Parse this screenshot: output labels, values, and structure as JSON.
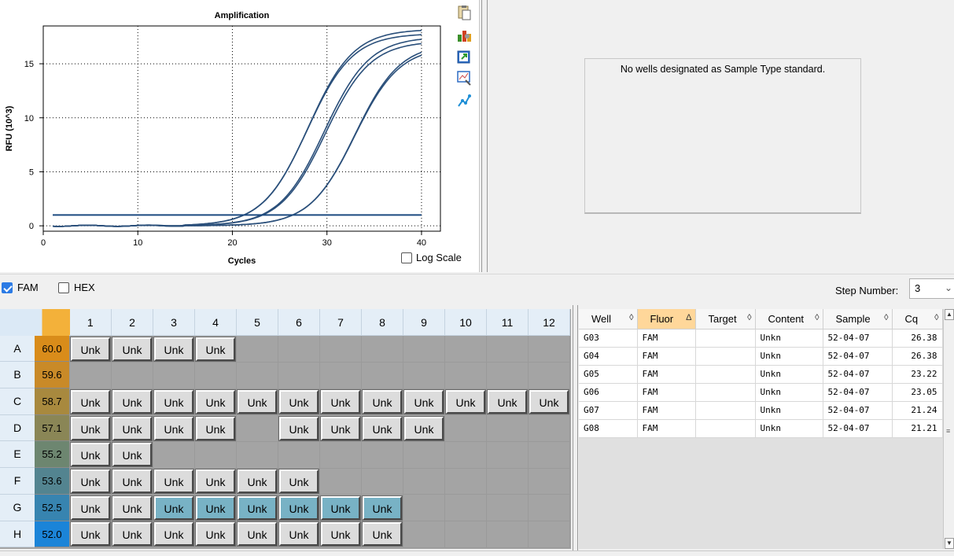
{
  "chart": {
    "log_scale_label": "Log Scale",
    "log_scale_checked": false,
    "toolbar_icons": [
      "clipboard-icon",
      "chart-tools-icon",
      "export-icon",
      "zoom-graph-icon",
      "line-chart-icon"
    ]
  },
  "chart_data": {
    "type": "line",
    "title": "Amplification",
    "xlabel": "Cycles",
    "ylabel": "RFU (10^3)",
    "xlim": [
      0,
      42
    ],
    "ylim": [
      -0.5,
      18.5
    ],
    "xticks": [
      0,
      10,
      20,
      30,
      40
    ],
    "yticks": [
      0,
      5,
      10,
      15
    ],
    "grid": true,
    "threshold": 1.0,
    "series": [
      {
        "cq": 21.21,
        "plateau": 17.8
      },
      {
        "cq": 21.24,
        "plateau": 18.2
      },
      {
        "cq": 23.05,
        "plateau": 17.5
      },
      {
        "cq": 23.22,
        "plateau": 17.1
      },
      {
        "cq": 26.38,
        "plateau": 16.9
      },
      {
        "cq": 26.38,
        "plateau": 16.6
      }
    ]
  },
  "standard_curve": {
    "message": "No wells designated as Sample Type standard."
  },
  "fluors": [
    {
      "label": "FAM",
      "checked": true
    },
    {
      "label": "HEX",
      "checked": false
    }
  ],
  "step": {
    "label": "Step Number:",
    "value": "3"
  },
  "plate": {
    "columns": [
      "1",
      "2",
      "3",
      "4",
      "5",
      "6",
      "7",
      "8",
      "9",
      "10",
      "11",
      "12"
    ],
    "rows": [
      {
        "label": "A",
        "temp": "60.0",
        "color": "#d98c1a",
        "wells": [
          "Unk",
          "Unk",
          "Unk",
          "Unk",
          "",
          "",
          "",
          "",
          "",
          "",
          "",
          ""
        ]
      },
      {
        "label": "B",
        "temp": "59.6",
        "color": "#c98a28",
        "wells": [
          "",
          "",
          "",
          "",
          "",
          "",
          "",
          "",
          "",
          "",
          "",
          ""
        ]
      },
      {
        "label": "C",
        "temp": "58.7",
        "color": "#a8893e",
        "wells": [
          "Unk",
          "Unk",
          "Unk",
          "Unk",
          "Unk",
          "Unk",
          "Unk",
          "Unk",
          "Unk",
          "Unk",
          "Unk",
          "Unk"
        ]
      },
      {
        "label": "D",
        "temp": "57.1",
        "color": "#8a8656",
        "wells": [
          "Unk",
          "Unk",
          "Unk",
          "Unk",
          "",
          "Unk",
          "Unk",
          "Unk",
          "Unk",
          "",
          "",
          ""
        ]
      },
      {
        "label": "E",
        "temp": "55.2",
        "color": "#6d8670",
        "wells": [
          "Unk",
          "Unk",
          "",
          "",
          "",
          "",
          "",
          "",
          "",
          "",
          "",
          ""
        ]
      },
      {
        "label": "F",
        "temp": "53.6",
        "color": "#538490",
        "wells": [
          "Unk",
          "Unk",
          "Unk",
          "Unk",
          "Unk",
          "Unk",
          "",
          "",
          "",
          "",
          "",
          ""
        ]
      },
      {
        "label": "G",
        "temp": "52.5",
        "color": "#3784b0",
        "wells": [
          "Unk",
          "Unk",
          "Unk",
          "Unk",
          "Unk",
          "Unk",
          "Unk",
          "Unk",
          "",
          "",
          "",
          ""
        ]
      },
      {
        "label": "H",
        "temp": "52.0",
        "color": "#1b84d8",
        "wells": [
          "Unk",
          "Unk",
          "Unk",
          "Unk",
          "Unk",
          "Unk",
          "Unk",
          "Unk",
          "",
          "",
          "",
          ""
        ]
      }
    ],
    "selected_row": "G",
    "selected_cols": [
      3,
      4,
      5,
      6,
      7,
      8
    ]
  },
  "results": {
    "headers": [
      {
        "label": "Well",
        "sort": "◊"
      },
      {
        "label": "Fluor",
        "sort": "Δ",
        "sorted": true
      },
      {
        "label": "Target",
        "sort": "◊"
      },
      {
        "label": "Content",
        "sort": "◊"
      },
      {
        "label": "Sample",
        "sort": "◊"
      },
      {
        "label": "Cq",
        "sort": "◊"
      }
    ],
    "rows": [
      [
        "G03",
        "FAM",
        "",
        "Unkn",
        "52-04-07",
        "26.38"
      ],
      [
        "G04",
        "FAM",
        "",
        "Unkn",
        "52-04-07",
        "26.38"
      ],
      [
        "G05",
        "FAM",
        "",
        "Unkn",
        "52-04-07",
        "23.22"
      ],
      [
        "G06",
        "FAM",
        "",
        "Unkn",
        "52-04-07",
        "23.05"
      ],
      [
        "G07",
        "FAM",
        "",
        "Unkn",
        "52-04-07",
        "21.24"
      ],
      [
        "G08",
        "FAM",
        "",
        "Unkn",
        "52-04-07",
        "21.21"
      ]
    ]
  }
}
